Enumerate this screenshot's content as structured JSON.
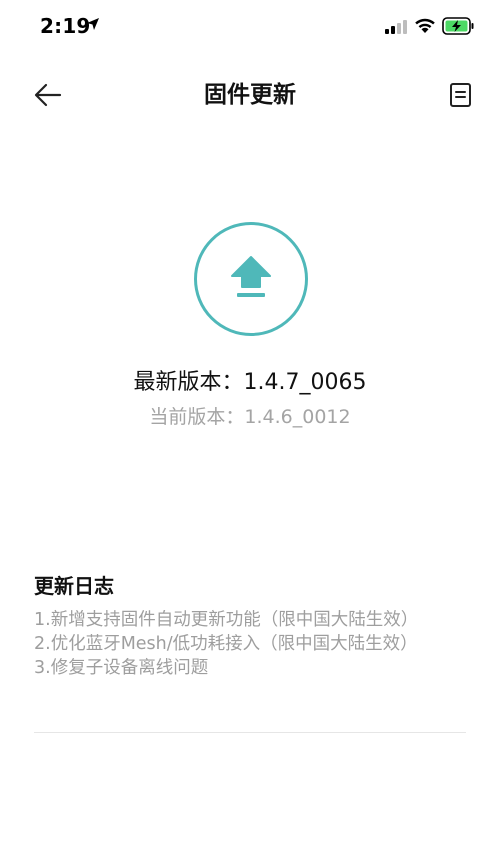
{
  "status_bar": {
    "time": "2:19"
  },
  "header": {
    "title": "固件更新"
  },
  "firmware": {
    "latest_version": "最新版本：1.4.7_0065",
    "current_version": "当前版本：1.4.6_0012"
  },
  "changelog": {
    "title": "更新日志",
    "items": [
      "1.新增支持固件自动更新功能（限中国大陆生效）",
      "2.优化蓝牙Mesh/低功耗接入（限中国大陆生效）",
      "3.修复子设备离线问题"
    ]
  },
  "colors": {
    "accent": "#4fb8b9",
    "battery": "#4cd964",
    "secondary_text": "#a4a4a4"
  }
}
